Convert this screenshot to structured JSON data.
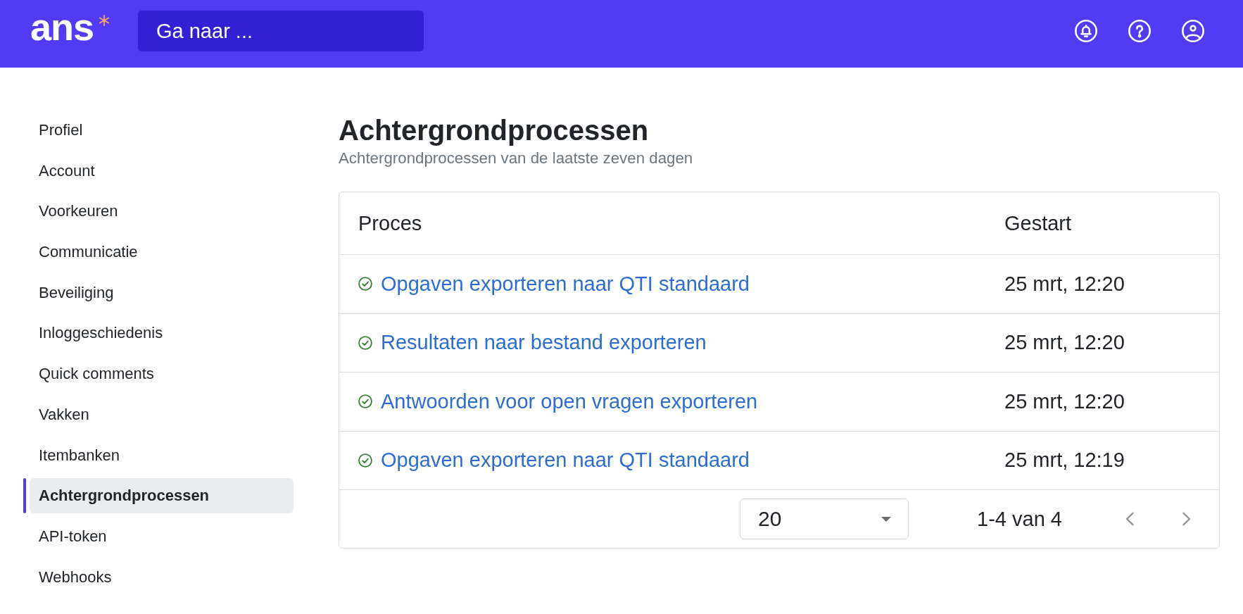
{
  "header": {
    "logo": "ans",
    "search": {
      "placeholder": "Ga naar ..."
    }
  },
  "sidebar": {
    "items": [
      {
        "label": "Profiel",
        "selected": false
      },
      {
        "label": "Account",
        "selected": false
      },
      {
        "label": "Voorkeuren",
        "selected": false
      },
      {
        "label": "Communicatie",
        "selected": false
      },
      {
        "label": "Beveiliging",
        "selected": false
      },
      {
        "label": "Inloggeschiedenis",
        "selected": false
      },
      {
        "label": "Quick comments",
        "selected": false
      },
      {
        "label": "Vakken",
        "selected": false
      },
      {
        "label": "Itembanken",
        "selected": false
      },
      {
        "label": "Achtergrondprocessen",
        "selected": true
      },
      {
        "label": "API-token",
        "selected": false
      },
      {
        "label": "Webhooks",
        "selected": false
      }
    ]
  },
  "page": {
    "title": "Achtergrondprocessen",
    "subtitle": "Achtergrondprocessen van de laatste zeven dagen"
  },
  "table": {
    "columns": [
      "Proces",
      "Gestart"
    ],
    "rows": [
      {
        "completed": true,
        "process": "Opgaven exporteren naar QTI standaard",
        "started": "25 mrt, 12:20"
      },
      {
        "completed": true,
        "process": "Resultaten naar bestand exporteren",
        "started": "25 mrt, 12:20"
      },
      {
        "completed": true,
        "process": "Antwoorden voor open vragen exporteren",
        "started": "25 mrt, 12:20"
      },
      {
        "completed": true,
        "process": "Opgaven exporteren naar QTI standaard",
        "started": "25 mrt, 12:19"
      }
    ],
    "pagination": {
      "page_size": "20",
      "range": "1-4 van 4",
      "previous": {
        "disabled": true
      },
      "next": {
        "disabled": true
      }
    }
  }
}
